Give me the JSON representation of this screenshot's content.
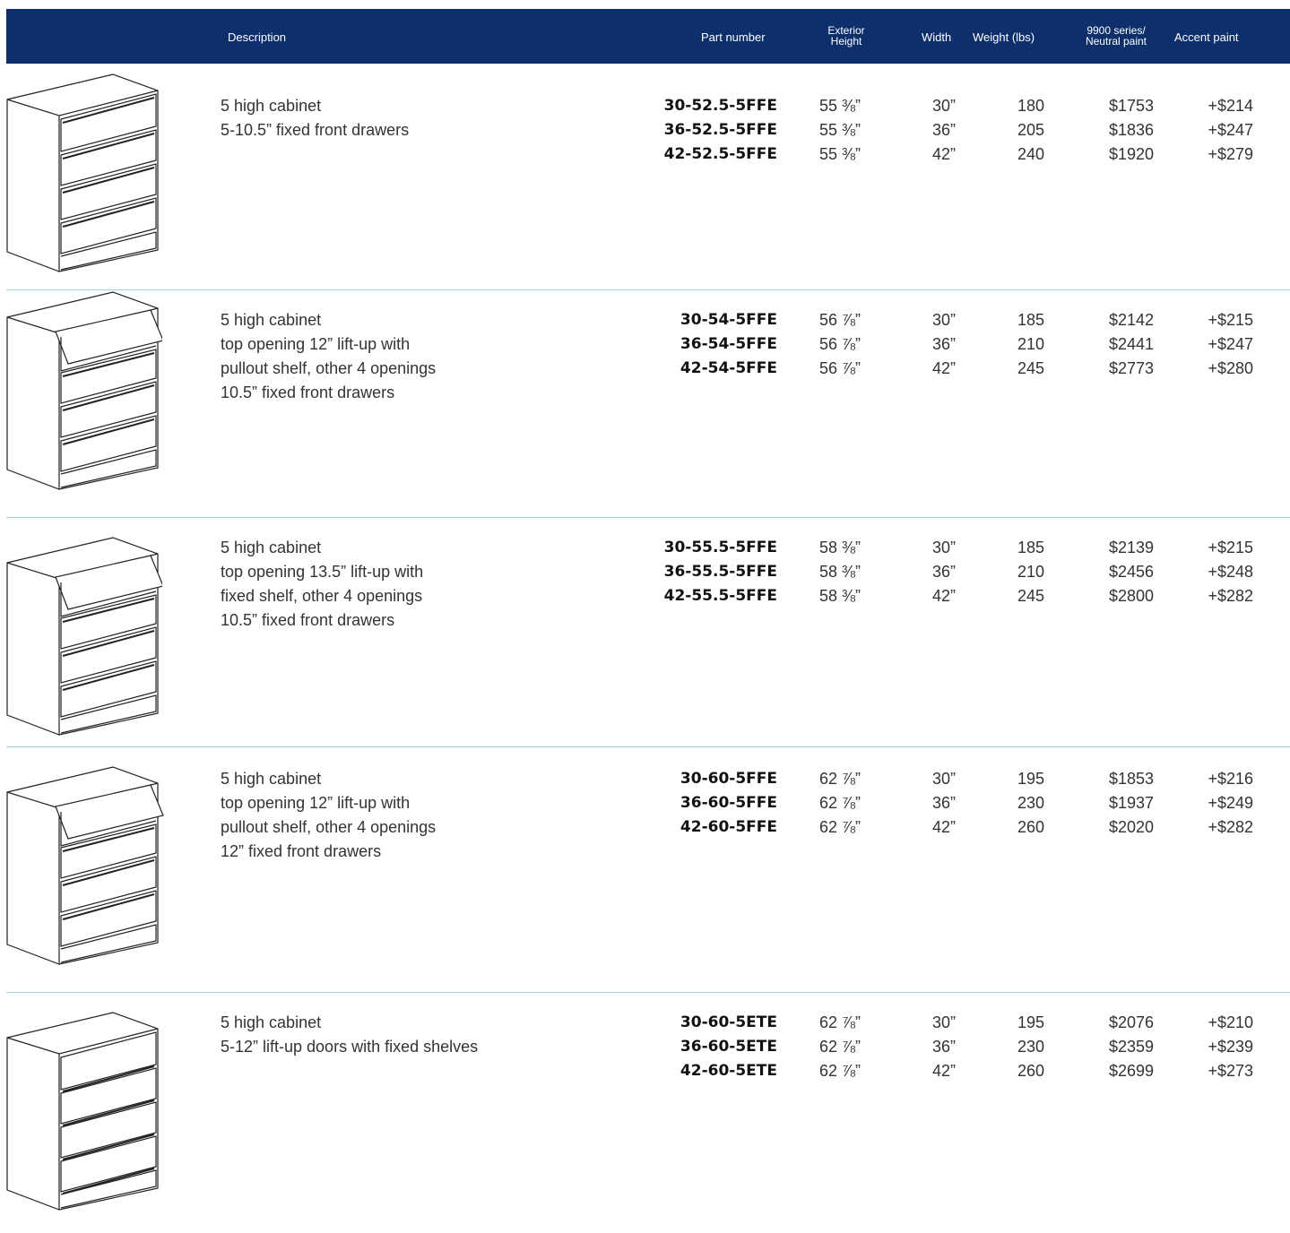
{
  "header": {
    "description": "Description",
    "part_number": "Part number",
    "exterior_height_l1": "Exterior",
    "exterior_height_l2": "Height",
    "width": "Width",
    "weight": "Weight (lbs)",
    "neutral_l1": "9900 series/",
    "neutral_l2": "Neutral paint",
    "accent": "Accent paint"
  },
  "colors": {
    "header_bg": "#0d2f6b",
    "divider": "#9fd4d9"
  },
  "rows": [
    {
      "illustration": "fixed-front-drawer-cabinet-icon",
      "description": [
        "5 high cabinet",
        "5-10.5” fixed front drawers"
      ],
      "parts": [
        {
          "part": "30-52.5-5FFE",
          "height": "55 ⅜”",
          "width": "30”",
          "weight": "180",
          "neutral": "$1753",
          "accent": "+$214"
        },
        {
          "part": "36-52.5-5FFE",
          "height": "55 ⅜”",
          "width": "36”",
          "weight": "205",
          "neutral": "$1836",
          "accent": "+$247"
        },
        {
          "part": "42-52.5-5FFE",
          "height": "55 ⅜”",
          "width": "42”",
          "weight": "240",
          "neutral": "$1920",
          "accent": "+$279"
        }
      ]
    },
    {
      "illustration": "lift-up-top-cabinet-icon",
      "description": [
        "5 high cabinet",
        "top opening 12” lift-up with",
        "pullout shelf, other 4 openings",
        "10.5” fixed front drawers"
      ],
      "parts": [
        {
          "part": "30-54-5FFE",
          "height": "56 ⅞”",
          "width": "30”",
          "weight": "185",
          "neutral": "$2142",
          "accent": "+$215"
        },
        {
          "part": "36-54-5FFE",
          "height": "56 ⅞”",
          "width": "36”",
          "weight": "210",
          "neutral": "$2441",
          "accent": "+$247"
        },
        {
          "part": "42-54-5FFE",
          "height": "56 ⅞”",
          "width": "42”",
          "weight": "245",
          "neutral": "$2773",
          "accent": "+$280"
        }
      ]
    },
    {
      "illustration": "lift-up-top-cabinet-icon",
      "description": [
        "5 high cabinet",
        "top opening 13.5” lift-up with",
        "fixed shelf, other 4 openings",
        "10.5” fixed front drawers"
      ],
      "parts": [
        {
          "part": "30-55.5-5FFE",
          "height": "58 ⅜”",
          "width": "30”",
          "weight": "185",
          "neutral": "$2139",
          "accent": "+$215"
        },
        {
          "part": "36-55.5-5FFE",
          "height": "58 ⅜”",
          "width": "36”",
          "weight": "210",
          "neutral": "$2456",
          "accent": "+$248"
        },
        {
          "part": "42-55.5-5FFE",
          "height": "58 ⅜”",
          "width": "42”",
          "weight": "245",
          "neutral": "$2800",
          "accent": "+$282"
        }
      ]
    },
    {
      "illustration": "lift-up-top-cabinet-icon",
      "description": [
        "5 high cabinet",
        "top opening 12” lift-up with",
        "pullout shelf, other 4 openings",
        "12” fixed front drawers"
      ],
      "parts": [
        {
          "part": "30-60-5FFE",
          "height": "62 ⅞”",
          "width": "30”",
          "weight": "195",
          "neutral": "$1853",
          "accent": "+$216"
        },
        {
          "part": "36-60-5FFE",
          "height": "62 ⅞”",
          "width": "36”",
          "weight": "230",
          "neutral": "$1937",
          "accent": "+$249"
        },
        {
          "part": "42-60-5FFE",
          "height": "62 ⅞”",
          "width": "42”",
          "weight": "260",
          "neutral": "$2020",
          "accent": "+$282"
        }
      ]
    },
    {
      "illustration": "lift-up-doors-cabinet-icon",
      "description": [
        "5 high cabinet",
        "5-12” lift-up doors with fixed shelves"
      ],
      "parts": [
        {
          "part": "30-60-5ETE",
          "height": "62 ⅞”",
          "width": "30”",
          "weight": "195",
          "neutral": "$2076",
          "accent": "+$210"
        },
        {
          "part": "36-60-5ETE",
          "height": "62 ⅞”",
          "width": "36”",
          "weight": "230",
          "neutral": "$2359",
          "accent": "+$239"
        },
        {
          "part": "42-60-5ETE",
          "height": "62 ⅞”",
          "width": "42”",
          "weight": "260",
          "neutral": "$2699",
          "accent": "+$273"
        }
      ]
    }
  ]
}
